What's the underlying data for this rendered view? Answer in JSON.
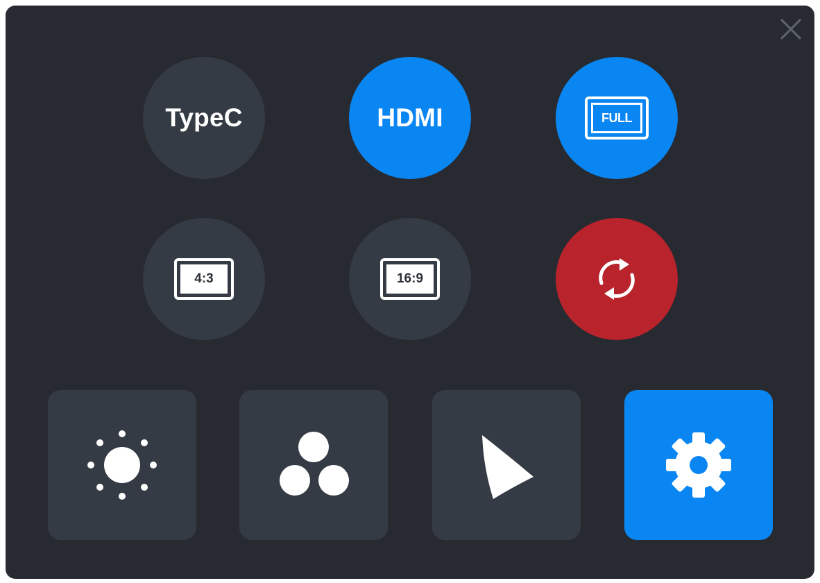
{
  "colors": {
    "panel_bg": "#272a30",
    "button_dark": "#353b44",
    "accent_blue": "#0a86f2",
    "accent_red": "#b8232c",
    "icon_white": "#ffffff"
  },
  "header": {
    "close_icon": "close-icon"
  },
  "source_row": {
    "typec_label": "TypeC",
    "hdmi_label": "HDMI",
    "full_label": "FULL"
  },
  "ratio_row": {
    "ratio_4_3_label": "4:3",
    "ratio_16_9_label": "16:9",
    "rotate_icon": "rotate-icon"
  },
  "tiles": [
    {
      "icon": "brightness-icon"
    },
    {
      "icon": "color-icon"
    },
    {
      "icon": "gamma-icon"
    },
    {
      "icon": "settings-icon"
    }
  ]
}
